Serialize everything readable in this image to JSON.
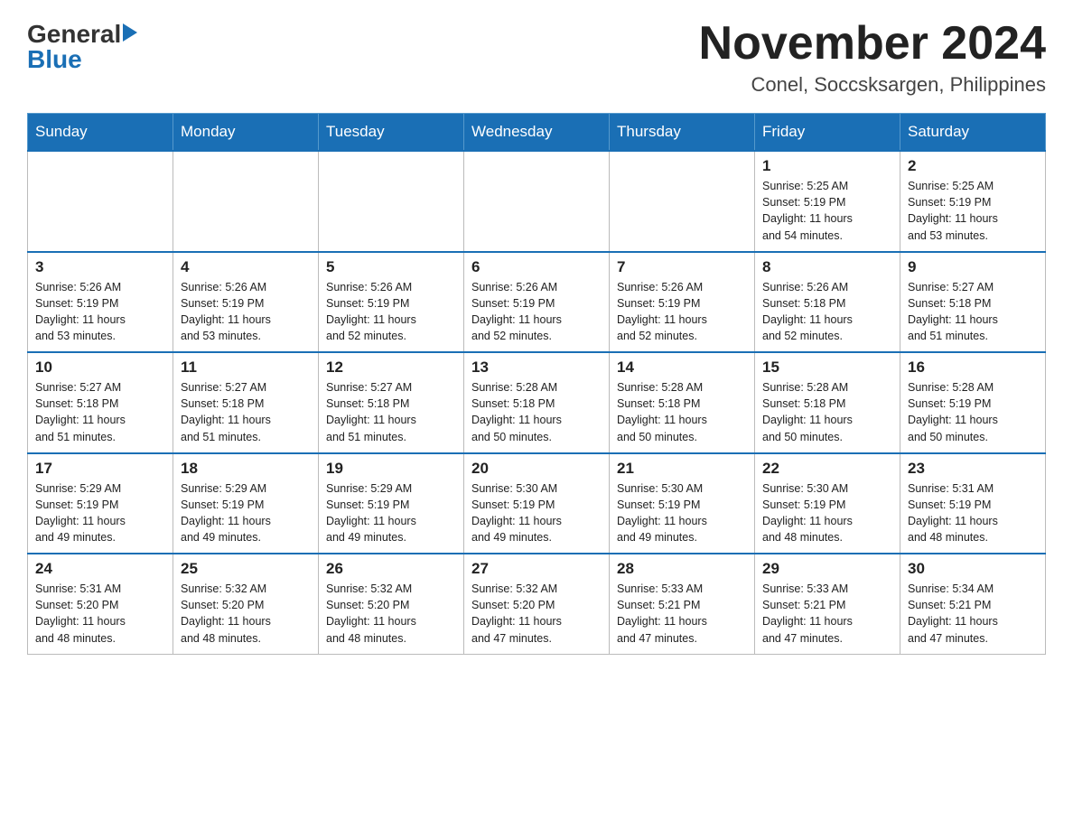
{
  "logo": {
    "general": "General",
    "blue": "Blue"
  },
  "title": {
    "month_year": "November 2024",
    "location": "Conel, Soccsksargen, Philippines"
  },
  "headers": [
    "Sunday",
    "Monday",
    "Tuesday",
    "Wednesday",
    "Thursday",
    "Friday",
    "Saturday"
  ],
  "weeks": [
    [
      {
        "day": "",
        "info": ""
      },
      {
        "day": "",
        "info": ""
      },
      {
        "day": "",
        "info": ""
      },
      {
        "day": "",
        "info": ""
      },
      {
        "day": "",
        "info": ""
      },
      {
        "day": "1",
        "info": "Sunrise: 5:25 AM\nSunset: 5:19 PM\nDaylight: 11 hours\nand 54 minutes."
      },
      {
        "day": "2",
        "info": "Sunrise: 5:25 AM\nSunset: 5:19 PM\nDaylight: 11 hours\nand 53 minutes."
      }
    ],
    [
      {
        "day": "3",
        "info": "Sunrise: 5:26 AM\nSunset: 5:19 PM\nDaylight: 11 hours\nand 53 minutes."
      },
      {
        "day": "4",
        "info": "Sunrise: 5:26 AM\nSunset: 5:19 PM\nDaylight: 11 hours\nand 53 minutes."
      },
      {
        "day": "5",
        "info": "Sunrise: 5:26 AM\nSunset: 5:19 PM\nDaylight: 11 hours\nand 52 minutes."
      },
      {
        "day": "6",
        "info": "Sunrise: 5:26 AM\nSunset: 5:19 PM\nDaylight: 11 hours\nand 52 minutes."
      },
      {
        "day": "7",
        "info": "Sunrise: 5:26 AM\nSunset: 5:19 PM\nDaylight: 11 hours\nand 52 minutes."
      },
      {
        "day": "8",
        "info": "Sunrise: 5:26 AM\nSunset: 5:18 PM\nDaylight: 11 hours\nand 52 minutes."
      },
      {
        "day": "9",
        "info": "Sunrise: 5:27 AM\nSunset: 5:18 PM\nDaylight: 11 hours\nand 51 minutes."
      }
    ],
    [
      {
        "day": "10",
        "info": "Sunrise: 5:27 AM\nSunset: 5:18 PM\nDaylight: 11 hours\nand 51 minutes."
      },
      {
        "day": "11",
        "info": "Sunrise: 5:27 AM\nSunset: 5:18 PM\nDaylight: 11 hours\nand 51 minutes."
      },
      {
        "day": "12",
        "info": "Sunrise: 5:27 AM\nSunset: 5:18 PM\nDaylight: 11 hours\nand 51 minutes."
      },
      {
        "day": "13",
        "info": "Sunrise: 5:28 AM\nSunset: 5:18 PM\nDaylight: 11 hours\nand 50 minutes."
      },
      {
        "day": "14",
        "info": "Sunrise: 5:28 AM\nSunset: 5:18 PM\nDaylight: 11 hours\nand 50 minutes."
      },
      {
        "day": "15",
        "info": "Sunrise: 5:28 AM\nSunset: 5:18 PM\nDaylight: 11 hours\nand 50 minutes."
      },
      {
        "day": "16",
        "info": "Sunrise: 5:28 AM\nSunset: 5:19 PM\nDaylight: 11 hours\nand 50 minutes."
      }
    ],
    [
      {
        "day": "17",
        "info": "Sunrise: 5:29 AM\nSunset: 5:19 PM\nDaylight: 11 hours\nand 49 minutes."
      },
      {
        "day": "18",
        "info": "Sunrise: 5:29 AM\nSunset: 5:19 PM\nDaylight: 11 hours\nand 49 minutes."
      },
      {
        "day": "19",
        "info": "Sunrise: 5:29 AM\nSunset: 5:19 PM\nDaylight: 11 hours\nand 49 minutes."
      },
      {
        "day": "20",
        "info": "Sunrise: 5:30 AM\nSunset: 5:19 PM\nDaylight: 11 hours\nand 49 minutes."
      },
      {
        "day": "21",
        "info": "Sunrise: 5:30 AM\nSunset: 5:19 PM\nDaylight: 11 hours\nand 49 minutes."
      },
      {
        "day": "22",
        "info": "Sunrise: 5:30 AM\nSunset: 5:19 PM\nDaylight: 11 hours\nand 48 minutes."
      },
      {
        "day": "23",
        "info": "Sunrise: 5:31 AM\nSunset: 5:19 PM\nDaylight: 11 hours\nand 48 minutes."
      }
    ],
    [
      {
        "day": "24",
        "info": "Sunrise: 5:31 AM\nSunset: 5:20 PM\nDaylight: 11 hours\nand 48 minutes."
      },
      {
        "day": "25",
        "info": "Sunrise: 5:32 AM\nSunset: 5:20 PM\nDaylight: 11 hours\nand 48 minutes."
      },
      {
        "day": "26",
        "info": "Sunrise: 5:32 AM\nSunset: 5:20 PM\nDaylight: 11 hours\nand 48 minutes."
      },
      {
        "day": "27",
        "info": "Sunrise: 5:32 AM\nSunset: 5:20 PM\nDaylight: 11 hours\nand 47 minutes."
      },
      {
        "day": "28",
        "info": "Sunrise: 5:33 AM\nSunset: 5:21 PM\nDaylight: 11 hours\nand 47 minutes."
      },
      {
        "day": "29",
        "info": "Sunrise: 5:33 AM\nSunset: 5:21 PM\nDaylight: 11 hours\nand 47 minutes."
      },
      {
        "day": "30",
        "info": "Sunrise: 5:34 AM\nSunset: 5:21 PM\nDaylight: 11 hours\nand 47 minutes."
      }
    ]
  ]
}
